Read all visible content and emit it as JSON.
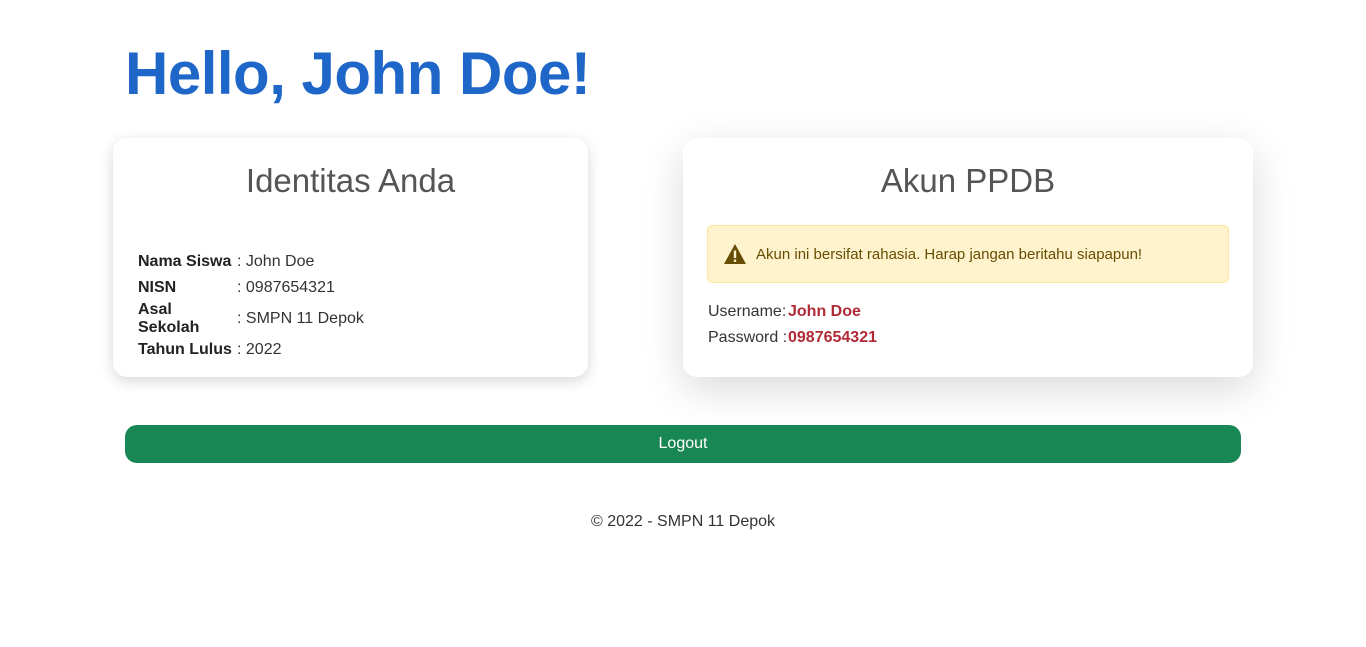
{
  "header": {
    "greeting": "Hello, John Doe!"
  },
  "identity_card": {
    "title": "Identitas Anda",
    "rows": [
      {
        "label": "Nama Siswa",
        "value": ": John Doe"
      },
      {
        "label": "NISN",
        "value": ": 0987654321"
      },
      {
        "label": "Asal Sekolah",
        "value": ": SMPN 11 Depok"
      },
      {
        "label": "Tahun Lulus",
        "value": ": 2022"
      }
    ]
  },
  "account_card": {
    "title": "Akun PPDB",
    "alert_text": "Akun ini bersifat rahasia. Harap jangan beritahu siapapun!",
    "username_label": "Username",
    "username_sep": ":",
    "username_value": "John Doe",
    "password_label": "Password",
    "password_sep": ":",
    "password_value": "0987654321",
    "alert_icon": "warning-triangle-icon"
  },
  "logout_label": "Logout",
  "footer_text": "© 2022 - SMPN 11 Depok",
  "colors": {
    "greeting": "#1f66c9",
    "logout_button": "#198754",
    "alert_bg": "#fff3cd",
    "credential_value": "#b02a37"
  }
}
